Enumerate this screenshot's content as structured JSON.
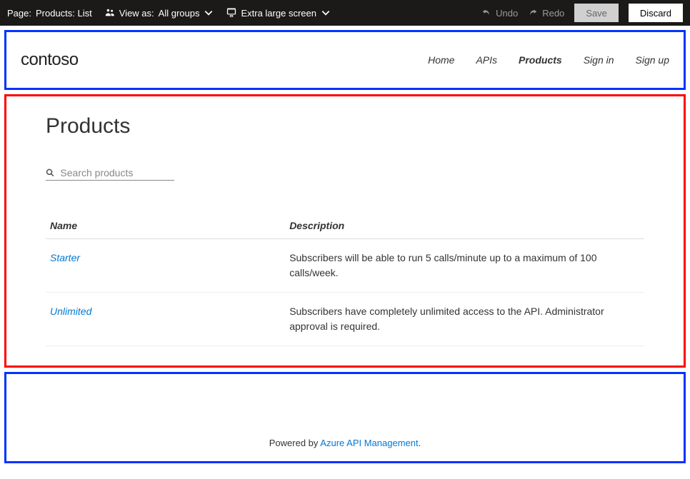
{
  "toolbar": {
    "page_label_prefix": "Page:",
    "page_label": "Products: List",
    "view_as_prefix": "View as:",
    "view_as_value": "All groups",
    "screen_label": "Extra large screen",
    "undo": "Undo",
    "redo": "Redo",
    "save": "Save",
    "discard": "Discard"
  },
  "header": {
    "brand": "contoso",
    "nav": {
      "home": "Home",
      "apis": "APIs",
      "products": "Products",
      "signin": "Sign in",
      "signup": "Sign up"
    }
  },
  "main": {
    "title": "Products",
    "search_placeholder": "Search products",
    "columns": {
      "name": "Name",
      "description": "Description"
    },
    "rows": [
      {
        "name": "Starter",
        "description": "Subscribers will be able to run 5 calls/minute up to a maximum of 100 calls/week."
      },
      {
        "name": "Unlimited",
        "description": "Subscribers have completely unlimited access to the API. Administrator approval is required."
      }
    ]
  },
  "footer": {
    "prefix": "Powered by ",
    "link_text": "Azure API Management",
    "suffix": "."
  }
}
